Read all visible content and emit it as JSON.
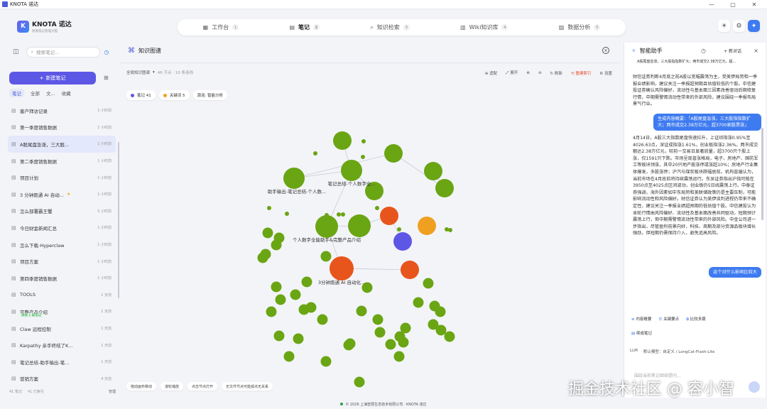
{
  "window": {
    "title": "KNOTA 诺达",
    "controls": [
      "—",
      "▢",
      "✕"
    ]
  },
  "brand": {
    "name": "KNOTA 诺达",
    "subtitle": "智能笔记管理大脑",
    "logo_letter": "K"
  },
  "nav": [
    {
      "label": "工作台",
      "badge": "1",
      "icon": "grid-icon"
    },
    {
      "label": "笔记",
      "badge": "2",
      "icon": "file-icon",
      "active": true
    },
    {
      "label": "知识检索",
      "badge": "3",
      "icon": "search-icon"
    },
    {
      "label": "Wiki知识库",
      "badge": "4",
      "icon": "book-icon"
    },
    {
      "label": "数据分析",
      "badge": "5",
      "icon": "chart-icon"
    }
  ],
  "sidebar": {
    "search_placeholder": "搜索笔记...",
    "new_note": "新建笔记",
    "tabs": [
      "笔记",
      "全部",
      "文...",
      "收藏"
    ],
    "notes": [
      {
        "title": "客户拜访记录",
        "time": "1 小时前"
      },
      {
        "title": "第一季度销售数据",
        "time": "1 小时前"
      },
      {
        "title": "A股尾盘急涨，三大股...",
        "time": "1 小时前",
        "active": true
      },
      {
        "title": "第二季度销售数据",
        "time": "1 小时前"
      },
      {
        "title": "项目计划",
        "time": "1 小时前"
      },
      {
        "title": "3 分钟跑通 AI 自动...",
        "time": "1 小时前",
        "starred": true
      },
      {
        "title": "怎么部署霸王蟹",
        "time": "5 小时前"
      },
      {
        "title": "今日财金新闻汇总",
        "time": "1 小时前"
      },
      {
        "title": "怎么下载-Hyperclaw",
        "time": "1 小时前"
      },
      {
        "title": "项目方案",
        "time": "1 小时前"
      },
      {
        "title": "第四季度销售数据",
        "time": "1 小时前"
      },
      {
        "title": "TOOLS",
        "time": "1 天前"
      },
      {
        "title": "完整产品介绍",
        "time": "1 天前",
        "badge": "关联 1 篇笔记"
      },
      {
        "title": "Claw 远程控制",
        "time": "1 天前"
      },
      {
        "title": "Karpathy 亲手终结了K...",
        "time": "1 天前"
      },
      {
        "title": "笔记总结-助手输出-笔...",
        "time": "1 天前"
      },
      {
        "title": "营销方案",
        "time": "4 天前"
      }
    ],
    "footer_count": "41 笔记",
    "footer_selected": "41 已索引",
    "footer_action": "管理"
  },
  "main": {
    "title": "知识图谱",
    "graph_mode": "全局知识图谱",
    "stats": "46 节点 · 10 条连线",
    "actions": [
      "适配",
      "展开",
      "",
      "",
      "刷新",
      "重建索引",
      "设置"
    ],
    "filters": [
      {
        "label": "笔记 41",
        "color": "#5d57e6"
      },
      {
        "label": "关键词 5",
        "color": "#f0a020"
      },
      {
        "label": "源泡: 智能分析",
        "color": ""
      }
    ],
    "node_labels": [
      "笔记总结-个人数字全...",
      "助手输出-笔记总结-个人数...",
      "个人数字全能助手&完整产品介绍",
      "3分钟跑通 AI 自动化..."
    ],
    "hints": [
      "拖动画布移动",
      "滚轮缩放",
      "点击节点打开",
      "无文件节点可能孤点无关系"
    ]
  },
  "footer": {
    "text": "© 2026 上海智慧生态技术有限公司 · KNOTA 诺达"
  },
  "assistant": {
    "title": "智能助手",
    "new_chat": "新对话",
    "subtitle": "A股尾盘急涨，三大股指指数扩大；两市成交2.38万亿元，超...",
    "ai_msg_1": "财信证券判断4月底之前A股以宽幅震荡为主，受美伊局势和一季报业绩影响，建议关注一季报超预期且估值较低的个股。中信建投证券确认风险偏好，流动性与基本面三因素改善驱动后期修复行情，中期需警惕流动性带来的外部风险，建议围绕一季报布局景气行业。",
    "user_msg_1": "生成内容概要：「A股尾盘急涨，三大股指指数扩大；两市成交2.38万亿元，超3700家股票涨」",
    "ai_msg_2": "4月14日，A股三大指数尾盘快速拉升，上证综指涨0.95%至4026.63点，深证成指涨1.61%，创业板指涨2.36%。两市成交额达2.38万亿元，较前一交易日显著放量，超3700只个股上涨，仅1591只下跌。市场呈现普涨格局，电子、房地产、国防军工等板块领涨，其中20只地产股涨停或涨超10%；房地产行业集体爆发，多股涨停；沪汽与煤炭板块跌幅居前。机构普遍认为，当前市场在4月底前将持续震荡运行。东吴证券指出沪指可能在3950点至4025点区间波动，创业板仍5日线震荡上行。中泰证券强调，海外因素如中东局势和美联储政策仍是主要压制，可能影响流动性和风险偏好。财信证券认为美伊谈判进程仍带来不确定性，建议关注一季报业绩超预期的低估值个股。中信建投认为本轮行情由风险偏好、流动性及基本面改善共同驱动，短期预计震荡上行，但中期需警惕流动性带来的外部风险。中金公司进一步指出，尽管盈利前景向好，科技、周期及部分资源品板块增长强劲，但短期仍需保持介入，避免追高风险。",
    "user_msg_2": "这个对什么影响比较大",
    "chips": [
      "内容概要",
      "关键要点",
      "比较多篇"
    ],
    "chip_extra": "续成笔记",
    "llm_label": "LLM",
    "model_label": "默认模型：自定义 / LongCat-Flash-Lite",
    "input_placeholder": "围绕当前笔记继续提问..."
  },
  "watermark": "掘金技术社区 @ 容小智",
  "colors": {
    "accent": "#5d57e6",
    "green": "#6aa513",
    "orange": "#f0a020",
    "red": "#e8551c",
    "purple": "#5d57e6"
  },
  "graph": {
    "nodes": [
      {
        "t": "g",
        "r": 13
      },
      {
        "t": "g",
        "r": 15
      },
      {
        "t": "g",
        "r": 15
      },
      {
        "t": "g",
        "r": 13
      },
      {
        "t": "g",
        "r": 13
      },
      {
        "t": "g",
        "r": 13
      },
      {
        "t": "g",
        "r": 13
      },
      {
        "t": "g",
        "r": 16
      },
      {
        "t": "g",
        "r": 16
      },
      {
        "t": "r",
        "r": 13
      },
      {
        "t": "o",
        "r": 13
      },
      {
        "t": "p",
        "r": 13
      },
      {
        "t": "r",
        "r": 17
      },
      {
        "t": "r",
        "r": 13
      }
    ]
  }
}
